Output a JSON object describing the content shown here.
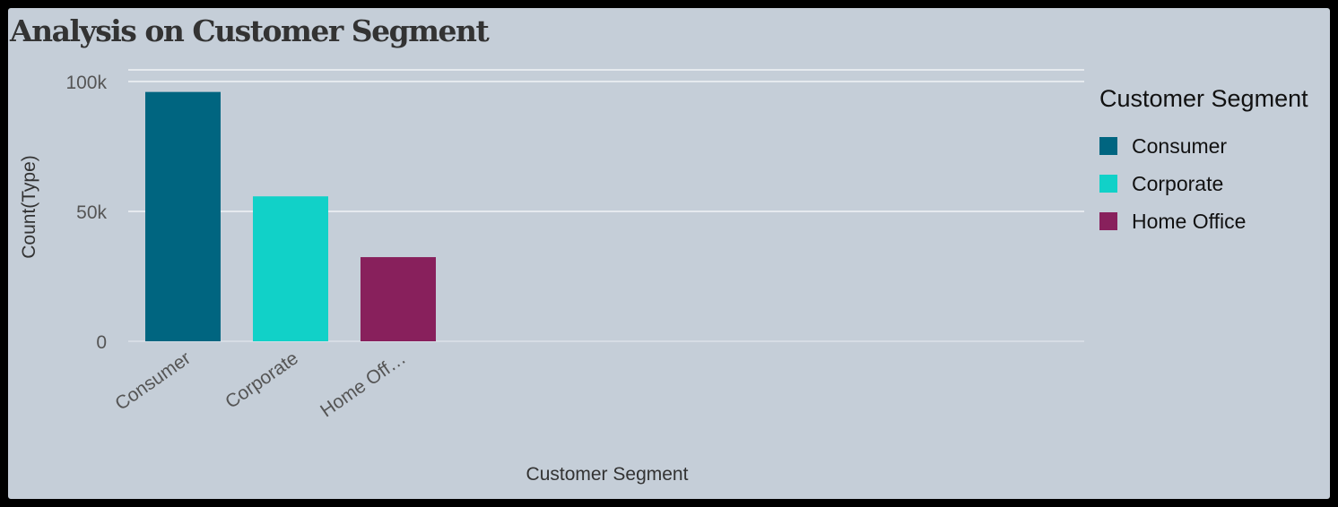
{
  "chart_data": {
    "type": "bar",
    "title": "Analysis on Customer Segment",
    "xlabel": "Customer Segment",
    "ylabel": "Count(Type)",
    "categories": [
      "Consumer",
      "Corporate",
      "Home Office"
    ],
    "tick_labels": [
      "Consumer",
      "Corporate",
      "Home Off…"
    ],
    "values": [
      96000,
      55800,
      32400
    ],
    "colors": [
      "#006580",
      "#11d1c8",
      "#88205c"
    ],
    "y_ticks": [
      0,
      50000,
      100000
    ],
    "y_tick_labels": [
      "0",
      "50k",
      "100k"
    ],
    "ylim": [
      0,
      104500
    ],
    "grid": true,
    "legend": {
      "title": "Customer Segment",
      "placement": "right",
      "entries": [
        "Consumer",
        "Corporate",
        "Home Office"
      ]
    }
  }
}
